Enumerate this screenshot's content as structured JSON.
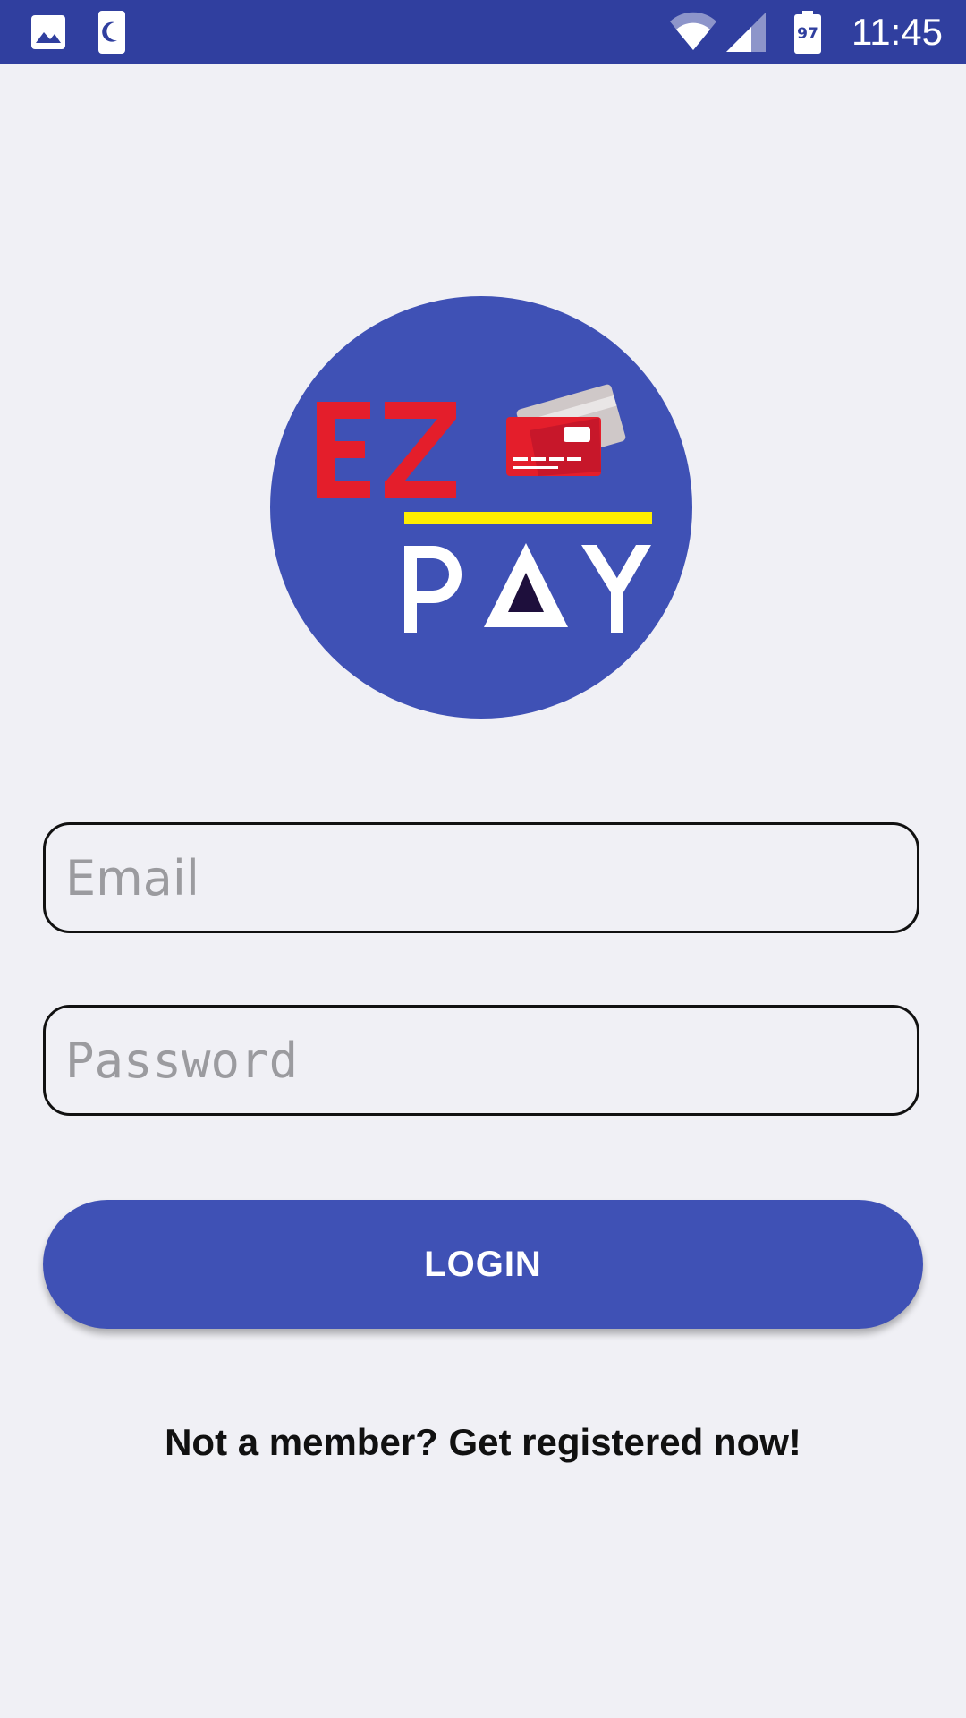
{
  "status_bar": {
    "time": "11:45",
    "battery_level": "97",
    "background_color": "#303f9f",
    "icons": [
      "image-icon",
      "moon-icon",
      "wifi-icon",
      "cell-signal-icon",
      "battery-icon"
    ]
  },
  "logo": {
    "line1": "EZ",
    "line2": "PAY",
    "circle_color": "#3f51b5",
    "accent_red": "#e41e2b",
    "accent_yellow": "#ffee00",
    "icon": "credit-card-icon"
  },
  "form": {
    "email_placeholder": "Email",
    "password_placeholder": "Password",
    "login_label": "LOGIN",
    "register_text": "Not a member? Get registered now!"
  },
  "colors": {
    "background": "#f0f0f5",
    "primary": "#3f51b5",
    "primary_dark": "#303f9f"
  }
}
